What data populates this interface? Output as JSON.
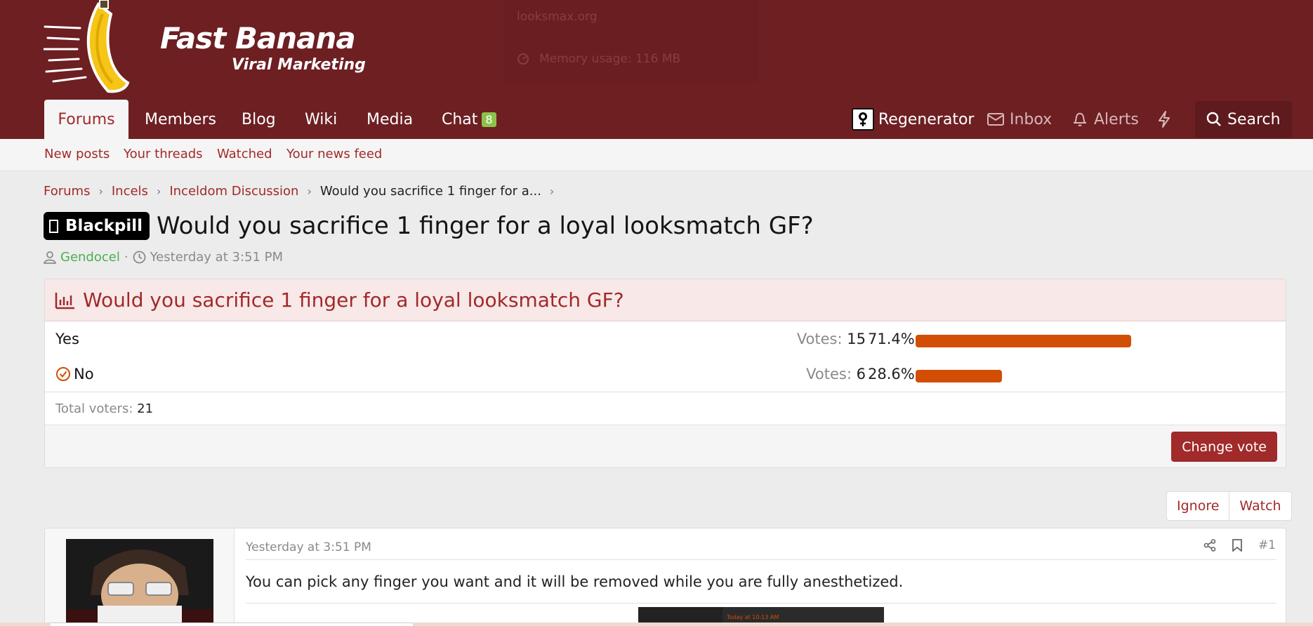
{
  "header": {
    "logo_title": "Fast Banana",
    "logo_subtitle": "Viral Marketing",
    "debug_host": "looksmax.org",
    "debug_memory": "Memory usage: 116 MB"
  },
  "nav": {
    "tabs": [
      {
        "label": "Forums"
      },
      {
        "label": "Members"
      },
      {
        "label": "Blog"
      },
      {
        "label": "Wiki"
      },
      {
        "label": "Media"
      },
      {
        "label": "Chat"
      }
    ],
    "chat_count": "8",
    "user": "Regenerator",
    "inbox": "Inbox",
    "alerts": "Alerts",
    "search": "Search"
  },
  "subnav": {
    "links": [
      "New posts",
      "Your threads",
      "Watched",
      "Your news feed"
    ]
  },
  "breadcrumb": [
    "Forums",
    "Incels",
    "Inceldom Discussion",
    "Would you sacrifice 1 finger for a..."
  ],
  "thread": {
    "prefix": "Blackpill",
    "title": "Would you sacrifice 1 finger for a loyal looksmatch GF?",
    "author": "Gendocel",
    "date": "Yesterday at 3:51 PM"
  },
  "poll": {
    "question": "Would you sacrifice 1 finger for a loyal looksmatch GF?",
    "votes_label": "Votes:",
    "options": [
      {
        "label": "Yes",
        "votes": "15",
        "percent": "71.4%",
        "fraction": 0.714,
        "selected": false
      },
      {
        "label": "No",
        "votes": "6",
        "percent": "28.6%",
        "fraction": 0.286,
        "selected": true
      }
    ],
    "total_label": "Total voters:",
    "total_voters": "21",
    "change_vote": "Change vote"
  },
  "actions": {
    "ignore": "Ignore",
    "watch": "Watch"
  },
  "post": {
    "date": "Yesterday at 3:51 PM",
    "number": "#1",
    "body": "You can pick any finger you want and it will be removed while you are fully anesthetized.",
    "embed_caption": "Today at 10:13 AM"
  },
  "colors": {
    "header_bg": "#6d1f22",
    "accent": "#a12a2a",
    "poll_bar": "#d24e04",
    "author": "#4caf50",
    "chat_badge": "#8bc34a"
  }
}
